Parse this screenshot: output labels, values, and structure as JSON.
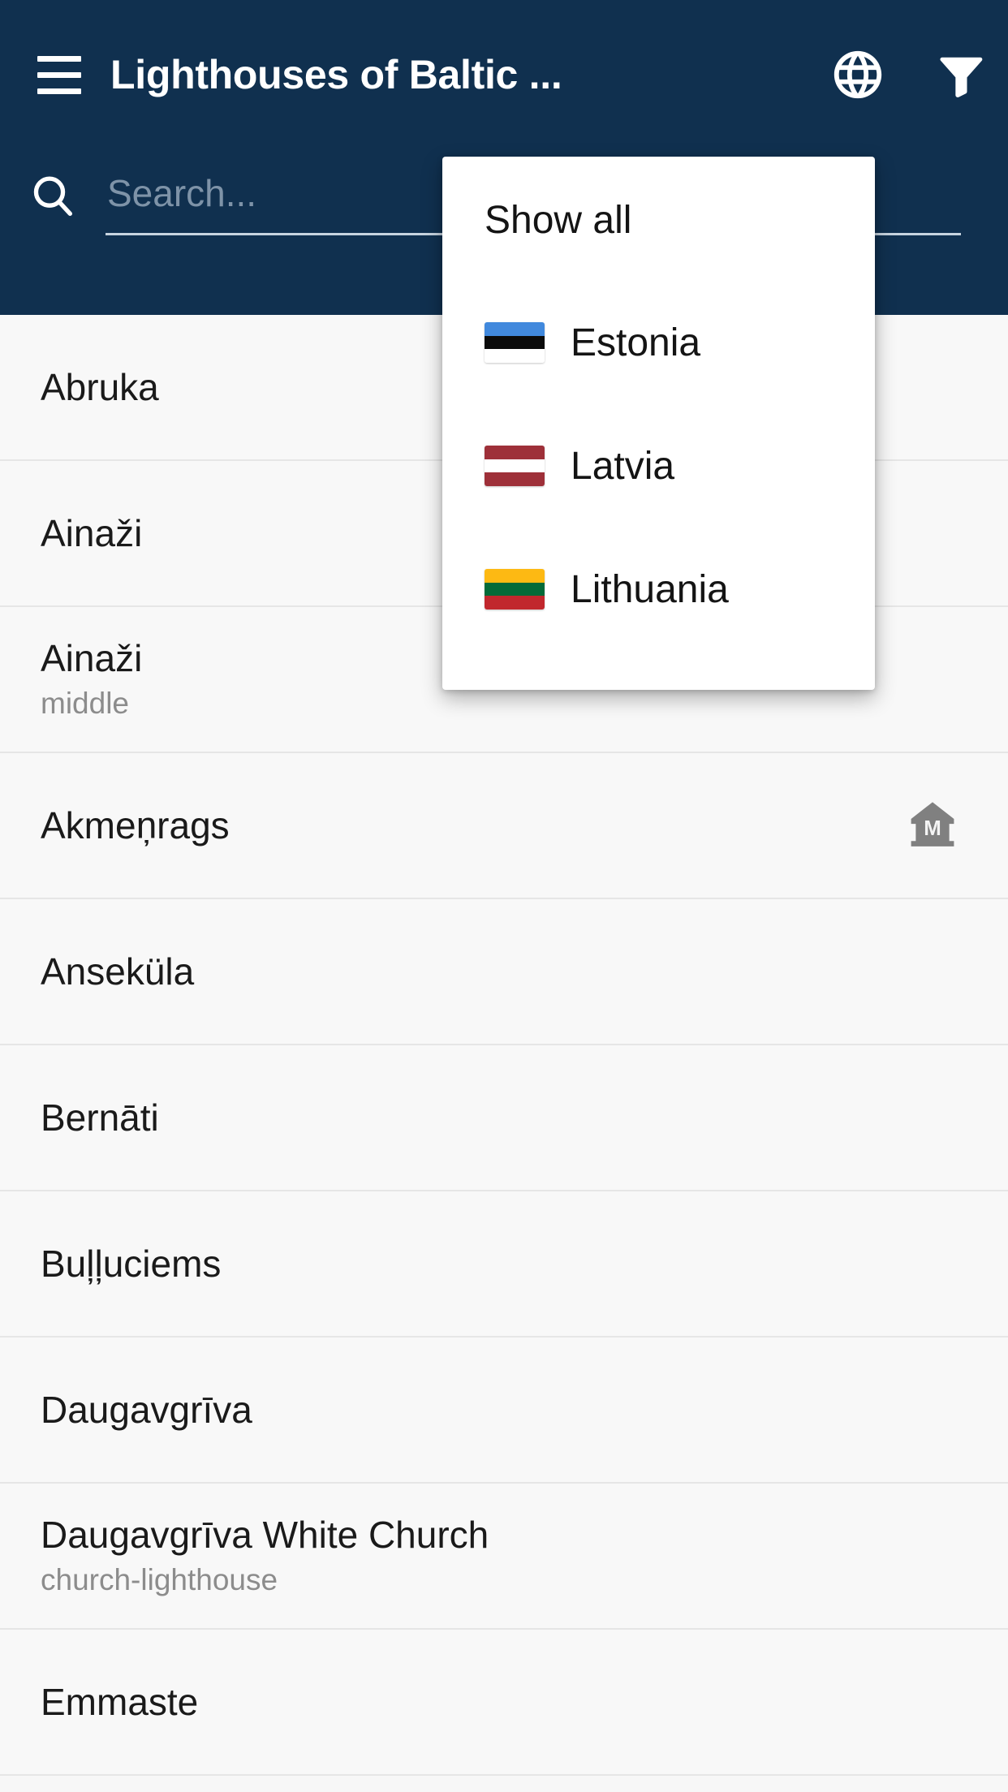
{
  "appbar": {
    "menu_icon": "hamburger-menu-icon",
    "title": "Lighthouses of Baltic ...",
    "actions": [
      {
        "name": "language-button",
        "icon": "globe-icon"
      },
      {
        "name": "filter-button",
        "icon": "funnel-filter-icon"
      }
    ]
  },
  "search": {
    "icon": "search-icon",
    "value": "",
    "placeholder": "Search..."
  },
  "filter_menu": {
    "visible": true,
    "items": [
      {
        "label": "Show all",
        "flag": null
      },
      {
        "label": "Estonia",
        "flag": "estonia",
        "colors": [
          "#4189DD",
          "#0B0B0B",
          "#FFFFFF"
        ]
      },
      {
        "label": "Latvia",
        "flag": "latvia",
        "colors": [
          "#9E3039",
          "#FFFFFF",
          "#9E3039"
        ]
      },
      {
        "label": "Lithuania",
        "flag": "lithuania",
        "colors": [
          "#FDB913",
          "#046A38",
          "#C1272D"
        ]
      }
    ]
  },
  "list": {
    "rows": [
      {
        "title": "Abruka",
        "subtitle": "",
        "badge": ""
      },
      {
        "title": "Ainaži",
        "subtitle": "",
        "badge": ""
      },
      {
        "title": "Ainaži",
        "subtitle": "middle",
        "badge": ""
      },
      {
        "title": "Akmeņrags",
        "subtitle": "",
        "badge": "museum-icon"
      },
      {
        "title": "Anseküla",
        "subtitle": "",
        "badge": ""
      },
      {
        "title": "Bernāti",
        "subtitle": "",
        "badge": ""
      },
      {
        "title": "Buļļuciems",
        "subtitle": "",
        "badge": ""
      },
      {
        "title": "Daugavgrīva",
        "subtitle": "",
        "badge": ""
      },
      {
        "title": "Daugavgrīva White Church",
        "subtitle": "church-lighthouse",
        "badge": ""
      },
      {
        "title": "Emmaste",
        "subtitle": "",
        "badge": ""
      }
    ]
  },
  "colors": {
    "appbar_background": "#10304f",
    "list_background": "#f8f8f8",
    "divider": "#e6e6e6",
    "title_text": "#ffffff",
    "placeholder_text": "#7e93a8",
    "row_title_text": "#1a1a1a",
    "row_subtitle_text": "#8c8c8c",
    "badge_icon": "#808080"
  }
}
